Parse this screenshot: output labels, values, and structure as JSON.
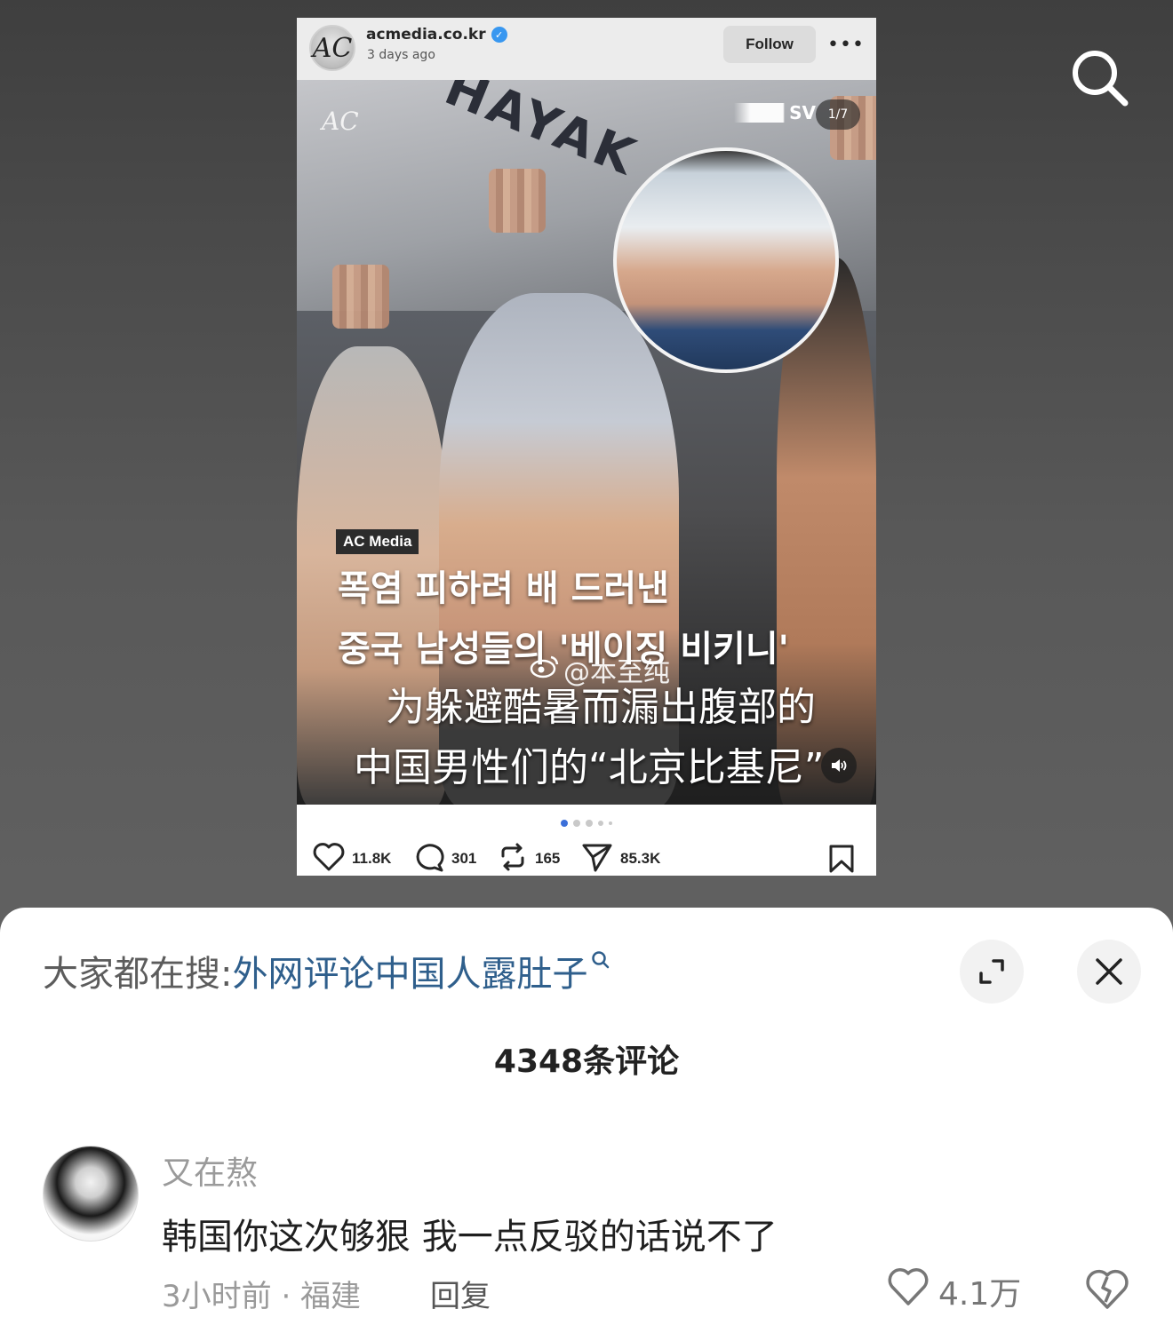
{
  "post": {
    "account": "acmedia.co.kr",
    "time": "3 days ago",
    "follow_label": "Follow",
    "more_label": "•••",
    "avatar_letter": "AC",
    "media": {
      "logo_text": "AC",
      "sign_text": "HAYAK",
      "sv_text": "SV",
      "page_counter": "1/7",
      "tag": "AC Media",
      "korean_line1": "폭염 피하려 배 드러낸",
      "korean_line2": "중국 남성들의 '베이징 비키니'",
      "chinese_line1": "为躲避酷暑而漏出腹部的",
      "chinese_line2": "中国男性们的“北京比基尼”",
      "watermark": "@本至纯"
    },
    "stats": {
      "likes": "11.8K",
      "comments": "301",
      "reposts": "165",
      "shares": "85.3K"
    }
  },
  "sheet": {
    "hot_search_prefix": "大家都在搜:",
    "hot_search_link": "外网评论中国人露肚子",
    "comment_count": "4348条评论"
  },
  "comment": {
    "username": "又在熬",
    "text": "韩国你这次够狠 我一点反驳的话说不了",
    "meta": "3小时前 · 福建",
    "reply_label": "回复",
    "likes": "4.1万"
  },
  "colors": {
    "link_blue": "#2f5f8c",
    "active_dot": "#3b6fd9",
    "verified_blue": "#3897f0"
  }
}
